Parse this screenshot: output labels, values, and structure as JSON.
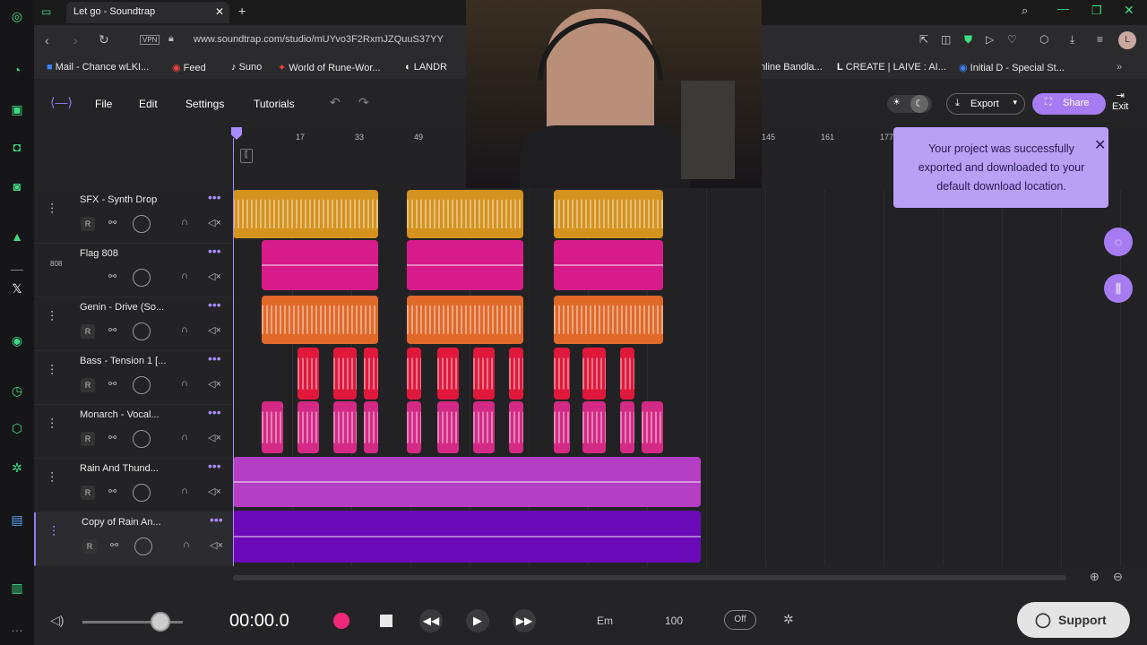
{
  "browser": {
    "tab_title": "Let go - Soundtrap",
    "url": "www.soundtrap.com/studio/mUYvo3F2RxmJZQuuS37YY",
    "bookmarks": [
      "Mail - Chance wLKI...",
      "Feed",
      "Suno",
      "World of Rune-Wor...",
      "LANDR",
      "nline Bandla...",
      "CREATE | LAIVE : AI...",
      "Initial D - Special St..."
    ]
  },
  "menu": {
    "file": "File",
    "edit": "Edit",
    "settings": "Settings",
    "tutorials": "Tutorials",
    "export": "Export",
    "share": "Share",
    "exit": "Exit"
  },
  "ruler": [
    "17",
    "33",
    "49",
    "145",
    "161",
    "177"
  ],
  "tracks": [
    {
      "name": "SFX - Synth Drop",
      "color": "#d4921e"
    },
    {
      "name": "Flag 808",
      "color": "#d81b8a"
    },
    {
      "name": "Genin - Drive (So...",
      "color": "#e0692a"
    },
    {
      "name": "Bass - Tension 1 [...",
      "color": "#e0183c"
    },
    {
      "name": "Monarch - Vocal...",
      "color": "#d42a86"
    },
    {
      "name": "Rain And Thund...",
      "color": "#b43ec4"
    },
    {
      "name": "Copy of Rain An...",
      "color": "#6a0ab8"
    }
  ],
  "track_icon_808": "808",
  "record_label": "R",
  "notification": "Your project was successfully exported and downloaded to your default download location.",
  "transport": {
    "time": "00:00.0",
    "key": "Em",
    "tempo": "100",
    "metronome": "Off",
    "support": "Support"
  }
}
